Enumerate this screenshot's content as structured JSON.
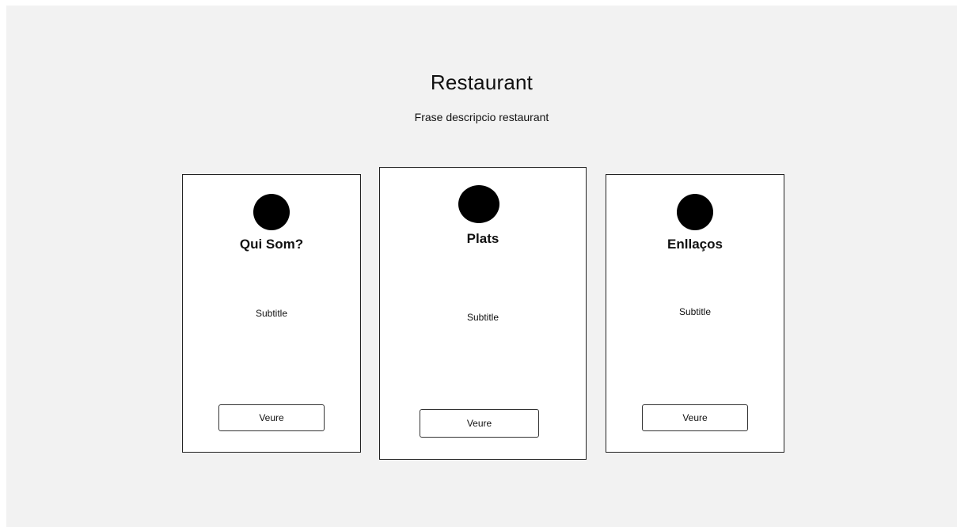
{
  "hero": {
    "title": "Restaurant",
    "subtitle": "Frase descripcio restaurant"
  },
  "cards": [
    {
      "title": "Qui Som?",
      "subtitle": "Subtitle",
      "button_label": "Veure",
      "icon": "circle-icon"
    },
    {
      "title": "Plats",
      "subtitle": "Subtitle",
      "button_label": "Veure",
      "icon": "circle-icon"
    },
    {
      "title": "Enllaços",
      "subtitle": "Subtitle",
      "button_label": "Veure",
      "icon": "circle-icon"
    }
  ],
  "colors": {
    "page_background": "#f2f2f2",
    "card_background": "#ffffff",
    "icon_fill": "#000000"
  }
}
